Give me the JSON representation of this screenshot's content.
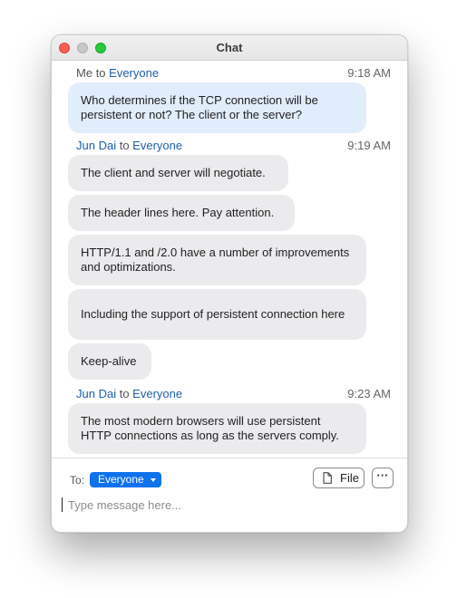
{
  "window": {
    "title": "Chat"
  },
  "messages": [
    {
      "sender": "Me",
      "to": "to",
      "recipient": "Everyone",
      "time": "9:18 AM",
      "bubbles": [
        "Who determines if the TCP connection will be persistent or not? The client or the server?"
      ]
    },
    {
      "sender": "Jun Dai",
      "to": "to",
      "recipient": "Everyone",
      "time": "9:19 AM",
      "bubbles": [
        "The client and server will negotiate.",
        "The header lines here. Pay attention.",
        "HTTP/1.1 and /2.0 have a number of improvements and optimizations.",
        "Including the support of persistent connection here",
        "Keep-alive"
      ]
    },
    {
      "sender": "Jun Dai",
      "to": "to",
      "recipient": "Everyone",
      "time": "9:23 AM",
      "bubbles": [
        "The most modern browsers will use persistent HTTP connections as long as the servers comply."
      ]
    }
  ],
  "composer": {
    "to_label": "To:",
    "recipient": "Everyone",
    "file_label": "File",
    "more_label": "···",
    "placeholder": "Type message here...",
    "value": ""
  },
  "colors": {
    "accent": "#0e72ed",
    "name_blue": "#1d5fa8",
    "my_bubble": "#e0edfb",
    "other_bubble": "#ebebee"
  },
  "icons": {
    "file": "file-icon",
    "more": "more-icon",
    "dropdown": "chevron-down-icon"
  }
}
